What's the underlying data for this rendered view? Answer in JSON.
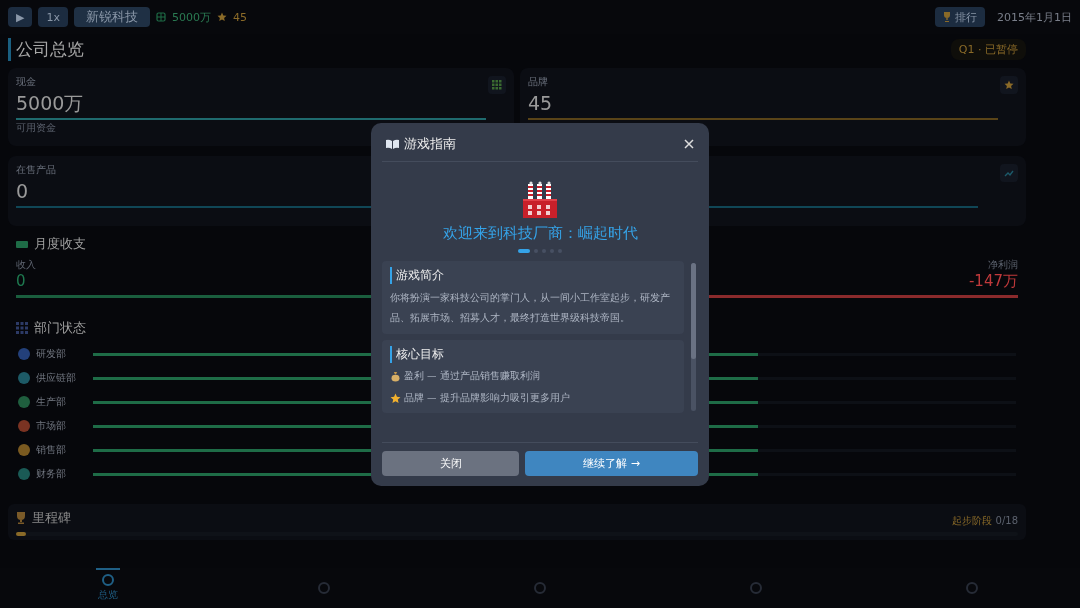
{
  "top_bar": {
    "play_button": "▶",
    "speed_button": "1x",
    "company_name": "新锐科技",
    "cash": "5000万",
    "stars": "45",
    "ranking_button": "排行",
    "date": "2015年1月1日"
  },
  "overview": {
    "title": "公司总览",
    "status_badge": "Q1 · 已暂停",
    "cards": [
      {
        "kind": "cash",
        "label": "现金",
        "value": "5000万",
        "caption": "可用资金",
        "color": "#1f6a6e"
      },
      {
        "kind": "brand",
        "label": "品牌",
        "value": "45",
        "color": "#5a4418"
      },
      {
        "kind": "products",
        "label": "在售产品",
        "value": "0",
        "color": "#104656"
      }
    ]
  },
  "monthly": {
    "title": "月度收支",
    "income_label": "收入",
    "income_value": "0",
    "profit_label": "净利润",
    "profit_value": "-147万"
  },
  "departments": {
    "title": "部门状态",
    "items": [
      {
        "name": "研发部",
        "color": "#23407a",
        "level": 0.72
      },
      {
        "name": "供应链部",
        "color": "#1d5a66",
        "level": 0.72
      },
      {
        "name": "生产部",
        "color": "#1f5e3e",
        "level": 0.72
      },
      {
        "name": "市场部",
        "color": "#7a3322",
        "level": 0.72
      },
      {
        "name": "销售部",
        "color": "#7a5a20",
        "level": 0.72
      },
      {
        "name": "财务部",
        "color": "#1a5a55",
        "level": 0.72
      }
    ]
  },
  "milestones": {
    "title": "里程碑",
    "stage": "起步阶段",
    "count": "0/18",
    "level": 0.01
  },
  "bottom_nav": [
    {
      "label": "总览",
      "selected": true
    },
    {
      "selected": false
    },
    {
      "selected": false
    },
    {
      "selected": false
    },
    {
      "selected": false
    }
  ],
  "guide_dialog": {
    "title": "游戏指南",
    "welcome": "欢迎来到科技厂商：崛起时代",
    "pages": [
      {
        "selected": true
      },
      {
        "selected": false
      },
      {
        "selected": false
      },
      {
        "selected": false
      },
      {
        "selected": false
      }
    ],
    "sections": [
      {
        "kind": "text",
        "heading": "游戏简介",
        "body": "你将扮演一家科技公司的掌门人，从一间小工作室起步，研发产品、拓展市场、招募人才，最终打造世界级科技帝国。"
      },
      {
        "kind": "list",
        "heading": "核心目标",
        "items": [
          {
            "kind": "money",
            "text": "盈利 — 通过产品销售赚取利润"
          },
          {
            "kind": "star",
            "text": "品牌 — 提升品牌影响力吸引更多用户"
          }
        ]
      }
    ],
    "close_button": "关闭",
    "next_button": "继续了解 →"
  }
}
